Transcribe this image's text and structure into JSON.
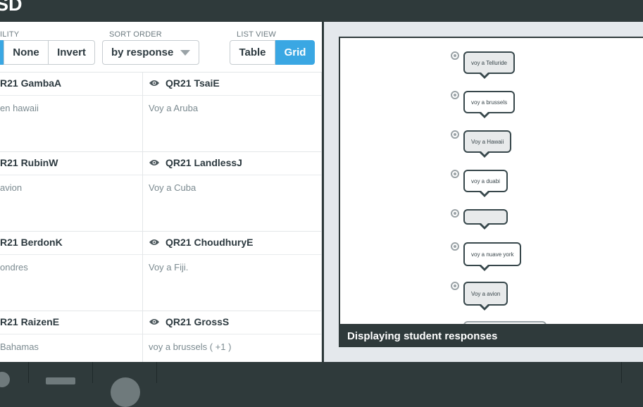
{
  "header": {
    "title": "SD"
  },
  "controls": {
    "visibility_label": "ILITY",
    "visibility_buttons": [
      {
        "label": ""
      },
      {
        "label": "None"
      },
      {
        "label": "Invert"
      }
    ],
    "sort_label": "SORT ORDER",
    "sort_value": "by response",
    "list_view_label": "LIST VIEW",
    "list_view_buttons": [
      {
        "label": "Table",
        "active": false
      },
      {
        "label": "Grid",
        "active": true
      }
    ]
  },
  "students": [
    {
      "name": "R21 GambaA",
      "response": "en hawaii"
    },
    {
      "name": "QR21 TsaiE",
      "response": "Voy a Aruba"
    },
    {
      "name": "R21 RubinW",
      "response": "avion"
    },
    {
      "name": "QR21 LandlessJ",
      "response": "Voy a Cuba"
    },
    {
      "name": "R21 BerdonK",
      "response": "ondres"
    },
    {
      "name": "QR21 ChoudhuryE",
      "response": "Voy a Fiji."
    },
    {
      "name": "R21 RaizenE",
      "response": "Bahamas"
    },
    {
      "name": "QR21 GrossS",
      "response": "voy a brussels ( +1 )"
    }
  ],
  "preview": {
    "bubbles": [
      {
        "text": "voy a Telluride",
        "style": "grey"
      },
      {
        "text": "voy a brussels",
        "style": "white"
      },
      {
        "text": "Voy a Hawaii",
        "style": "grey"
      },
      {
        "text": "voy a duabi",
        "style": "white"
      },
      {
        "text": "",
        "style": "grey"
      },
      {
        "text": "voy a nuave york",
        "style": "white"
      },
      {
        "text": "Voy a avion",
        "style": "grey"
      }
    ],
    "caption": "Displaying student responses"
  },
  "colors": {
    "accent": "#3aa7e3",
    "dark": "#2f3a3b"
  }
}
